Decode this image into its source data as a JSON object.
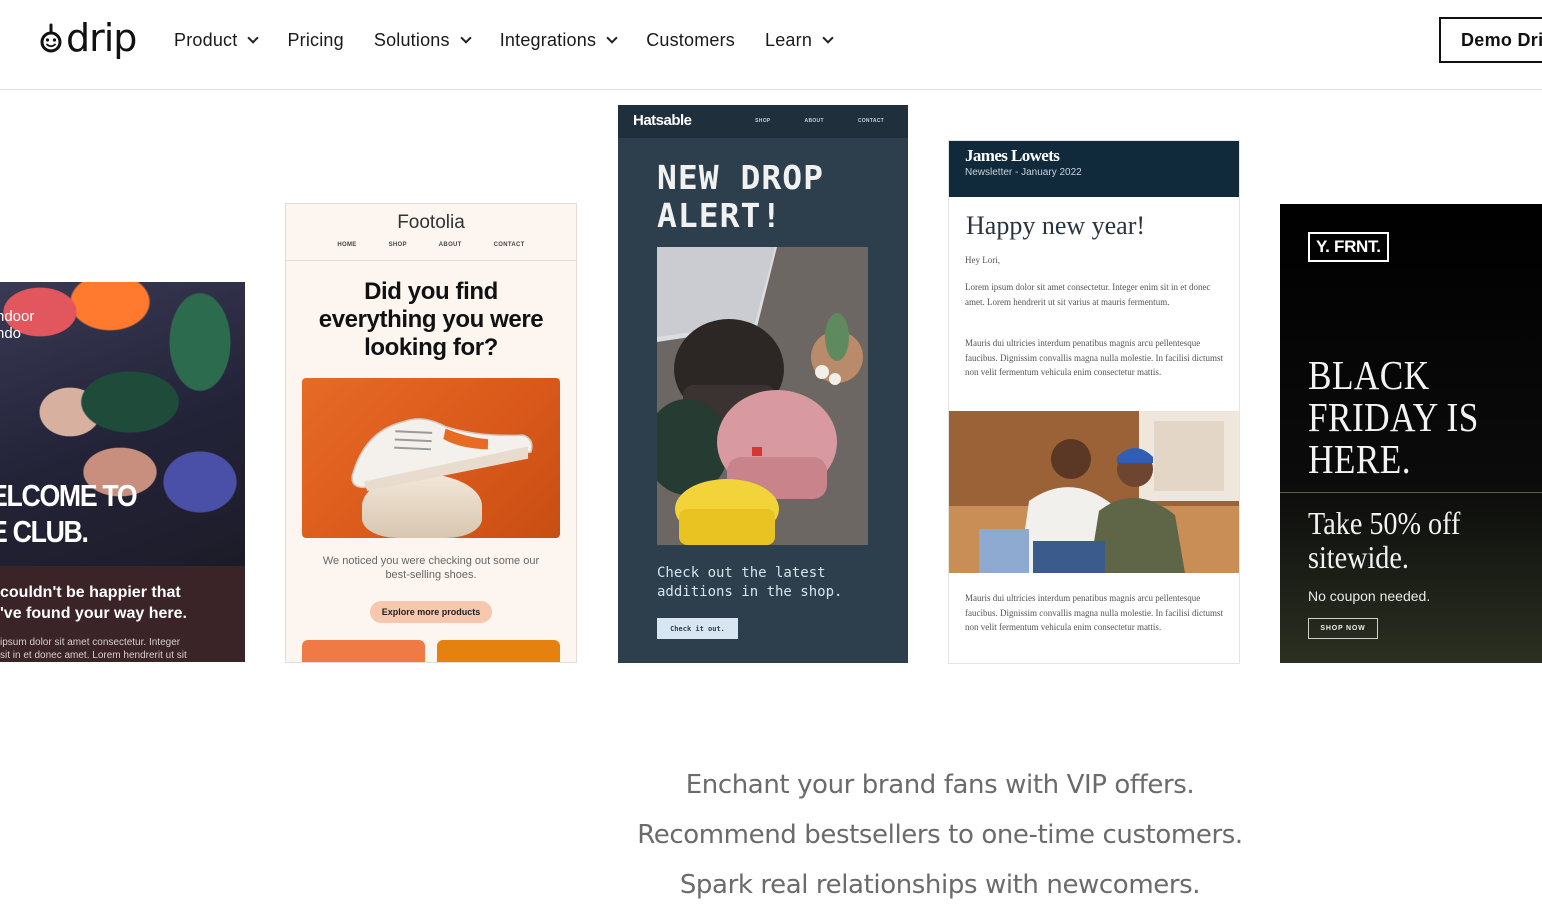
{
  "header": {
    "logo_text": "drip",
    "nav": [
      {
        "label": "Product",
        "has_menu": true
      },
      {
        "label": "Pricing",
        "has_menu": false
      },
      {
        "label": "Solutions",
        "has_menu": true
      },
      {
        "label": "Integrations",
        "has_menu": true
      },
      {
        "label": "Customers",
        "has_menu": false
      },
      {
        "label": "Learn",
        "has_menu": true
      }
    ],
    "demo_button": "Demo Dri"
  },
  "cards": {
    "club": {
      "photo_text": "ndoor\nndo",
      "headline": "ELCOME TO\nE CLUB.",
      "sub": "couldn't be happier that\n've found your way here.",
      "body": "ipsum dolor sit amet consectetur. Integer\nsit in et donec amet. Lorem hendrerit ut sit"
    },
    "footolia": {
      "brand": "Footolia",
      "nav": [
        "HOME",
        "SHOP",
        "ABOUT",
        "CONTACT"
      ],
      "headline": "Did you find\neverything you were\nlooking for?",
      "note": "We noticed you were checking out some our\nbest-selling shoes.",
      "button": "Explore more products"
    },
    "hatsable": {
      "brand": "Hatsable",
      "nav": [
        "SHOP",
        "ABOUT",
        "CONTACT"
      ],
      "headline": "NEW DROP\nALERT!",
      "copy": "Check out the latest\nadditions in the shop.",
      "button": "Check it out."
    },
    "james": {
      "brand": "James Lowets",
      "sub": "Newsletter - January 2022",
      "headline": "Happy new year!",
      "greeting": "Hey Lori,",
      "p1": "Lorem ipsum dolor sit amet consectetur. Integer enim sit in et donec amet. Lorem hendrerit ut sit varius at mauris fermentum.",
      "p2": "Mauris dui ultricies interdum penatibus magnis arcu pellentesque faucibus. Dignissim convallis magna nulla molestie. In facilisi dictumst non velit fermentum vehicula enim consectetur mattis.",
      "p3": "Mauris dui ultricies interdum penatibus magnis arcu pellentesque faucibus. Dignissim convallis magna nulla molestie. In facilisi dictumst non velit fermentum vehicula enim consectetur mattis."
    },
    "yfrnt": {
      "logo": "Y. FRNT.",
      "headline": "BLACK\nFRIDAY IS\nHERE.",
      "offer": "Take 50% off\nsitewide.",
      "note": "No coupon needed.",
      "button": "SHOP NOW"
    }
  },
  "taglines": [
    "Enchant your brand fans with VIP offers.",
    "Recommend bestsellers to one-time customers.",
    "Spark real relationships with newcomers."
  ]
}
